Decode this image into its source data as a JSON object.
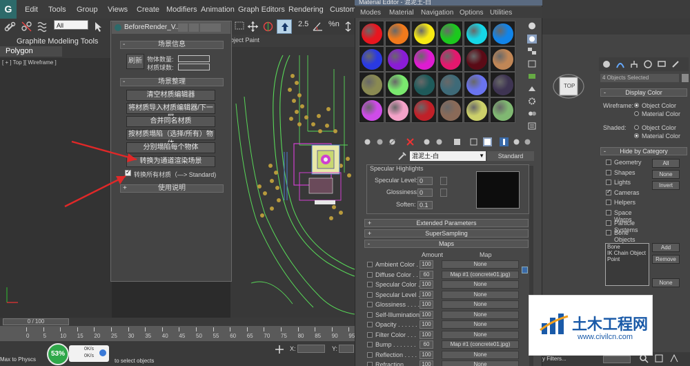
{
  "menubar": {
    "items": [
      "Edit",
      "Tools",
      "Group",
      "Views",
      "Create",
      "Modifiers",
      "Animation",
      "Graph Editors",
      "Rendering",
      "Custom"
    ]
  },
  "toolbar": {
    "selection_filter": "All",
    "snap_value": "2.5",
    "percent_label": "%n"
  },
  "ribbon": {
    "tab1": "Graphite Modeling Tools",
    "tab2": "Polygon Modeling"
  },
  "viewport": {
    "label": "[ + ] Top ][ Wireframe ]",
    "paint_label": "bject Paint"
  },
  "before_render": {
    "title": "BeforeRender_V...",
    "section_info": "场景信息",
    "refresh": "刷新",
    "object_count_label": "物体数量:",
    "material_count_label": "材质球数:",
    "section_organize": "场景整理",
    "buttons": [
      "清空材质编辑器",
      "将材质导入材质编辑器/下一屏",
      "合并同名材质",
      "按材质塌陷（选择/所有）物体",
      "分别塌陷每个物体",
      "转换为通道渲染场景"
    ],
    "convert_all_label": "转换所有材质（—> Standard)",
    "section_help": "使用说明"
  },
  "material_editor": {
    "title": "Material Editor - 混泥土-白",
    "menu": [
      "Modes",
      "Material",
      "Navigation",
      "Options",
      "Utilities"
    ],
    "slot_colors": [
      "#e8161f",
      "#f07a1c",
      "#f8ea14",
      "#1cc81e",
      "#16d6e6",
      "#1284e8",
      "#2a3ae2",
      "#8a1cd6",
      "#de1cd0",
      "#e4186e",
      "#5a0b16",
      "#c08656",
      "#8a8a52",
      "#7ae86e",
      "#1e5a5a",
      "#3e6a78",
      "#6a74f0",
      "#3e3452",
      "#ce4ce8",
      "#f4a2c8",
      "#c02028",
      "#8a6a58",
      "#ccd06a",
      "#80b872"
    ],
    "material_name": "混泥土-白",
    "material_type": "Standard",
    "specular_header": "Specular Highlights",
    "specular_level_label": "Specular Level:",
    "specular_level": "0",
    "glossiness_label": "Glossiness:",
    "glossiness": "0",
    "soften_label": "Soften:",
    "soften": "0.1",
    "extended_params": "Extended Parameters",
    "supersampling": "SuperSampling",
    "maps_header": "Maps",
    "amount_header": "Amount",
    "map_header": "Map",
    "maps": [
      {
        "name": "Ambient Color . .",
        "amount": "100",
        "map": "None"
      },
      {
        "name": "Diffuse Color . .",
        "amount": "60",
        "map": "Map #1 (concrete01.jpg)"
      },
      {
        "name": "Specular Color .",
        "amount": "100",
        "map": "None"
      },
      {
        "name": "Specular Level .",
        "amount": "100",
        "map": "None"
      },
      {
        "name": "Glossiness . . . .",
        "amount": "100",
        "map": "None"
      },
      {
        "name": "Self-Illumination .",
        "amount": "100",
        "map": "None"
      },
      {
        "name": "Opacity . . . . . .",
        "amount": "100",
        "map": "None"
      },
      {
        "name": "Filter Color . . .",
        "amount": "100",
        "map": "None"
      },
      {
        "name": "Bump . . . . . . .",
        "amount": "60",
        "map": "Map #1 (concrete01.jpg)"
      },
      {
        "name": "Reflection . . . .",
        "amount": "100",
        "map": "None"
      },
      {
        "name": "Refraction . . . .",
        "amount": "100",
        "map": "None"
      }
    ]
  },
  "command_panel": {
    "viewcube_label": "TOP",
    "selection": "4 Objects Selected",
    "display_color": "Display Color",
    "wireframe_label": "Wireframe:",
    "shaded_label": "Shaded:",
    "object_color": "Object Color",
    "material_color": "Material Color",
    "hide_by_category": "Hide by Category",
    "categories": [
      "Geometry",
      "Shapes",
      "Lights",
      "Cameras",
      "Helpers",
      "Space Warps",
      "Particle Systems",
      "Bone Objects"
    ],
    "all_btn": "All",
    "none_btn": "None",
    "invert_btn": "Invert",
    "list_items": [
      "Bone",
      "IK Chain Object",
      "Point"
    ],
    "add_btn": "Add",
    "remove_btn": "Remove",
    "none_btn2": "None"
  },
  "bottom": {
    "time": "0 / 100",
    "ticks": [
      "0",
      "5",
      "10",
      "15",
      "20",
      "25",
      "30",
      "35",
      "40",
      "45",
      "50",
      "55",
      "60",
      "65",
      "70",
      "75",
      "80",
      "85",
      "90",
      "95"
    ],
    "status_left": "Max to Physcs",
    "status_text": "to select objects",
    "x_label": "X:",
    "y_label": "Y:",
    "perf_percent": "53%",
    "net_up": "0K/s",
    "net_down": "0K/s",
    "filters_label": "y Filters..."
  },
  "watermark": {
    "title": "土木工程网",
    "url": "www.civilcn.com"
  },
  "colors": {
    "wire_green": "#58d858",
    "wire_tree": "#b89a3c",
    "wire_magenta": "#d040d0",
    "arrow_red": "#e02828"
  }
}
